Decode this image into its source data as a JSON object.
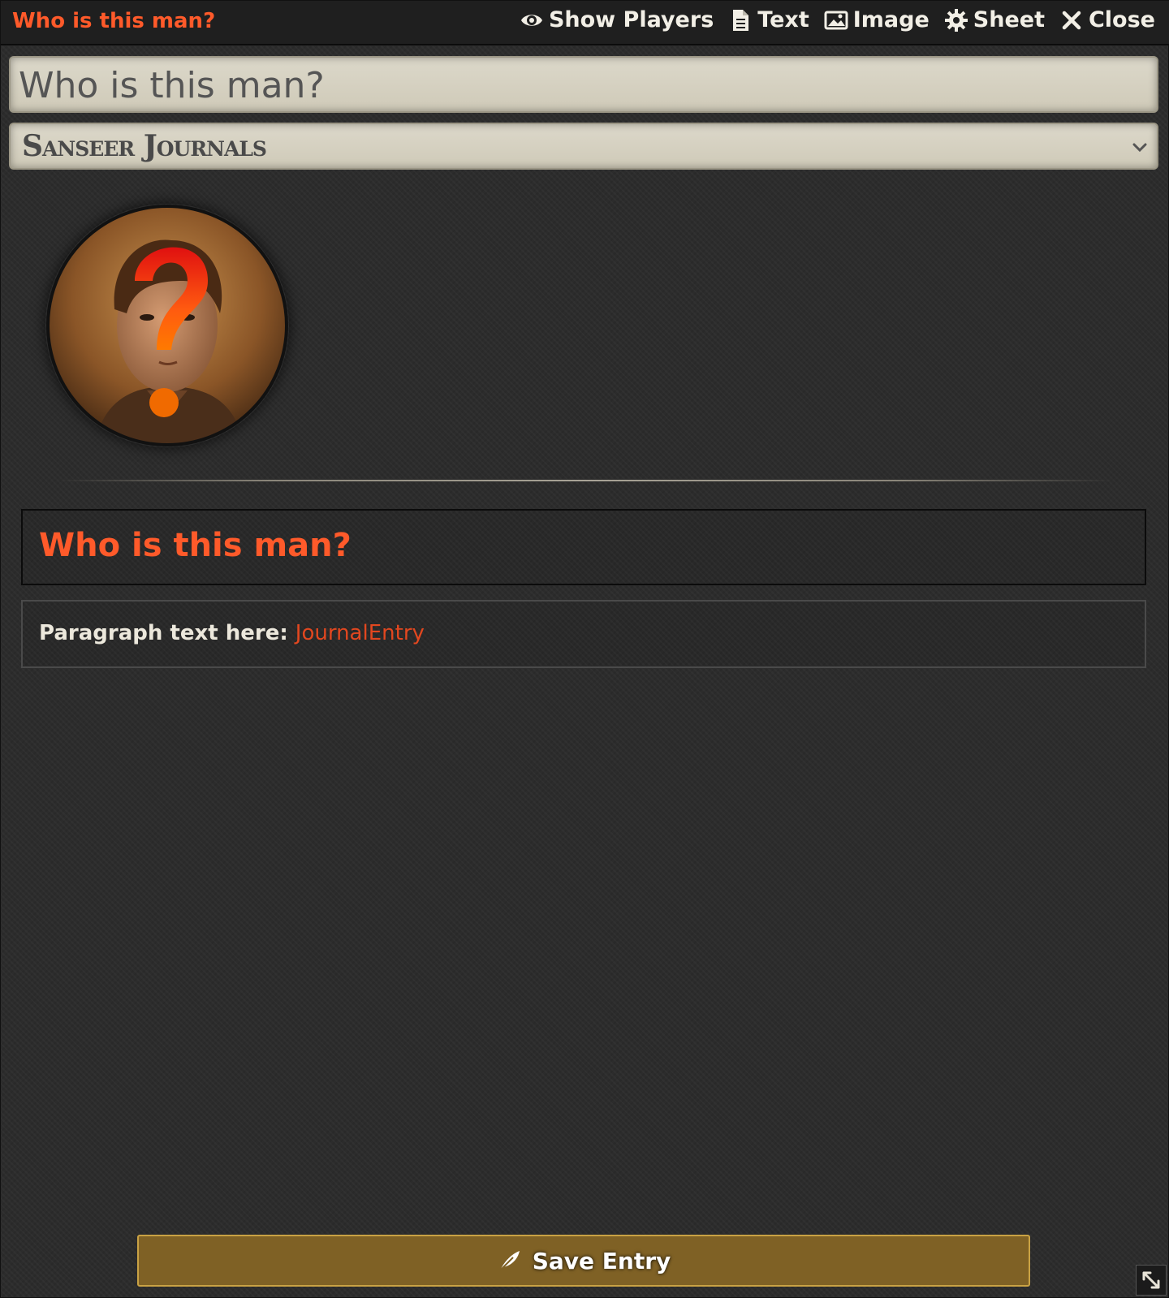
{
  "window": {
    "title": "Who is this man?",
    "controls": [
      {
        "label": "Show Players",
        "icon": "eye-icon"
      },
      {
        "label": "Text",
        "icon": "file-text-icon"
      },
      {
        "label": "Image",
        "icon": "image-icon"
      },
      {
        "label": "Sheet",
        "icon": "gear-icon"
      },
      {
        "label": "Close",
        "icon": "close-icon"
      }
    ]
  },
  "form": {
    "name_value": "Who is this man?",
    "folder_value": "Sanseer Journals"
  },
  "content": {
    "heading": "Who is this man?",
    "paragraph_prefix": "Paragraph text here: ",
    "paragraph_link": "JournalEntry"
  },
  "footer": {
    "save_label": "Save Entry"
  },
  "colors": {
    "accent": "#ff5a2a",
    "save_button": "#7f6125",
    "save_button_border": "#c9a244"
  }
}
